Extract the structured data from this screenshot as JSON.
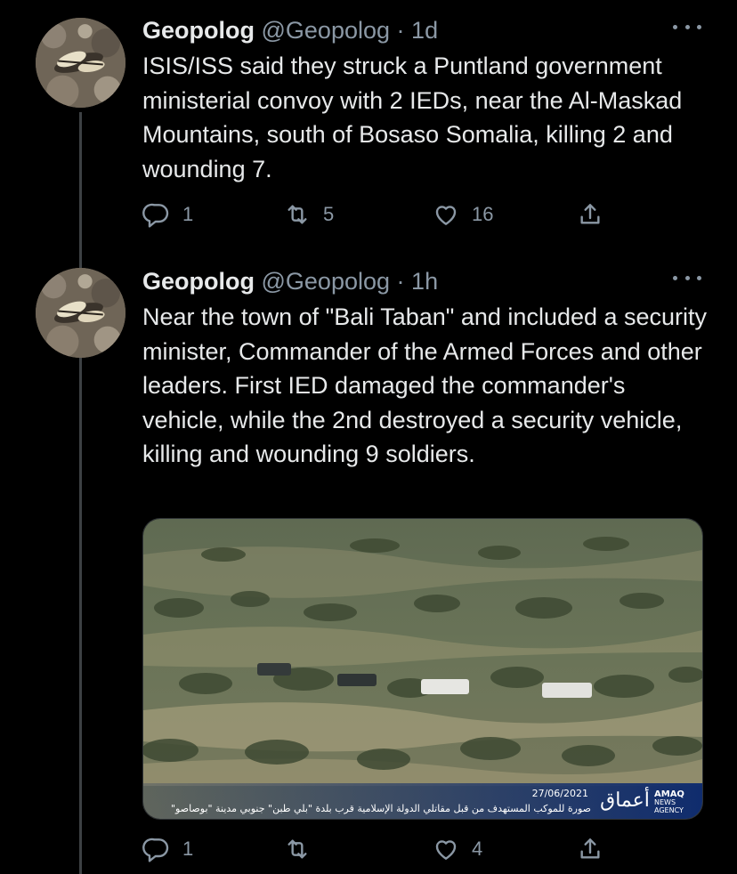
{
  "tweets": [
    {
      "name": "Geopolog",
      "handle": "@Geopolog",
      "separator": "·",
      "time": "1d",
      "text": "ISIS/ISS said they struck a Puntland government ministerial convoy with 2 IEDs, near the Al-Maskad Mountains, south of Bosaso Somalia, killing 2 and wounding 7.",
      "actions": {
        "reply": "1",
        "retweet": "5",
        "like": "16"
      }
    },
    {
      "name": "Geopolog",
      "handle": "@Geopolog",
      "separator": "·",
      "time": "1h",
      "text": "Near the town of \"Bali Taban\" and included a security minister, Commander of the Armed Forces and other leaders. First IED damaged the commander's vehicle, while the 2nd destroyed a security vehicle, killing and wounding 9 soldiers.",
      "actions": {
        "reply": "1",
        "retweet": "",
        "like": "4"
      },
      "media": {
        "date": "27/06/2021",
        "caption": "صورة للموكب المستهدف من قبل مقاتلي الدولة الإسلامية قرب بلدة \"بلي طبن\" جنوبي مدينة \"بوصاصو\"",
        "logo_text": "أعماق",
        "agency_line1": "AMAQ",
        "agency_line2": "NEWS",
        "agency_line3": "AGENCY"
      }
    }
  ],
  "colors": {
    "background": "#000000",
    "text": "#e7e9ea",
    "secondary": "#8b98a5",
    "thread_line": "#3d4144"
  },
  "icons": [
    "reply-icon",
    "retweet-icon",
    "like-icon",
    "share-icon",
    "more-icon",
    "avatar-image"
  ]
}
